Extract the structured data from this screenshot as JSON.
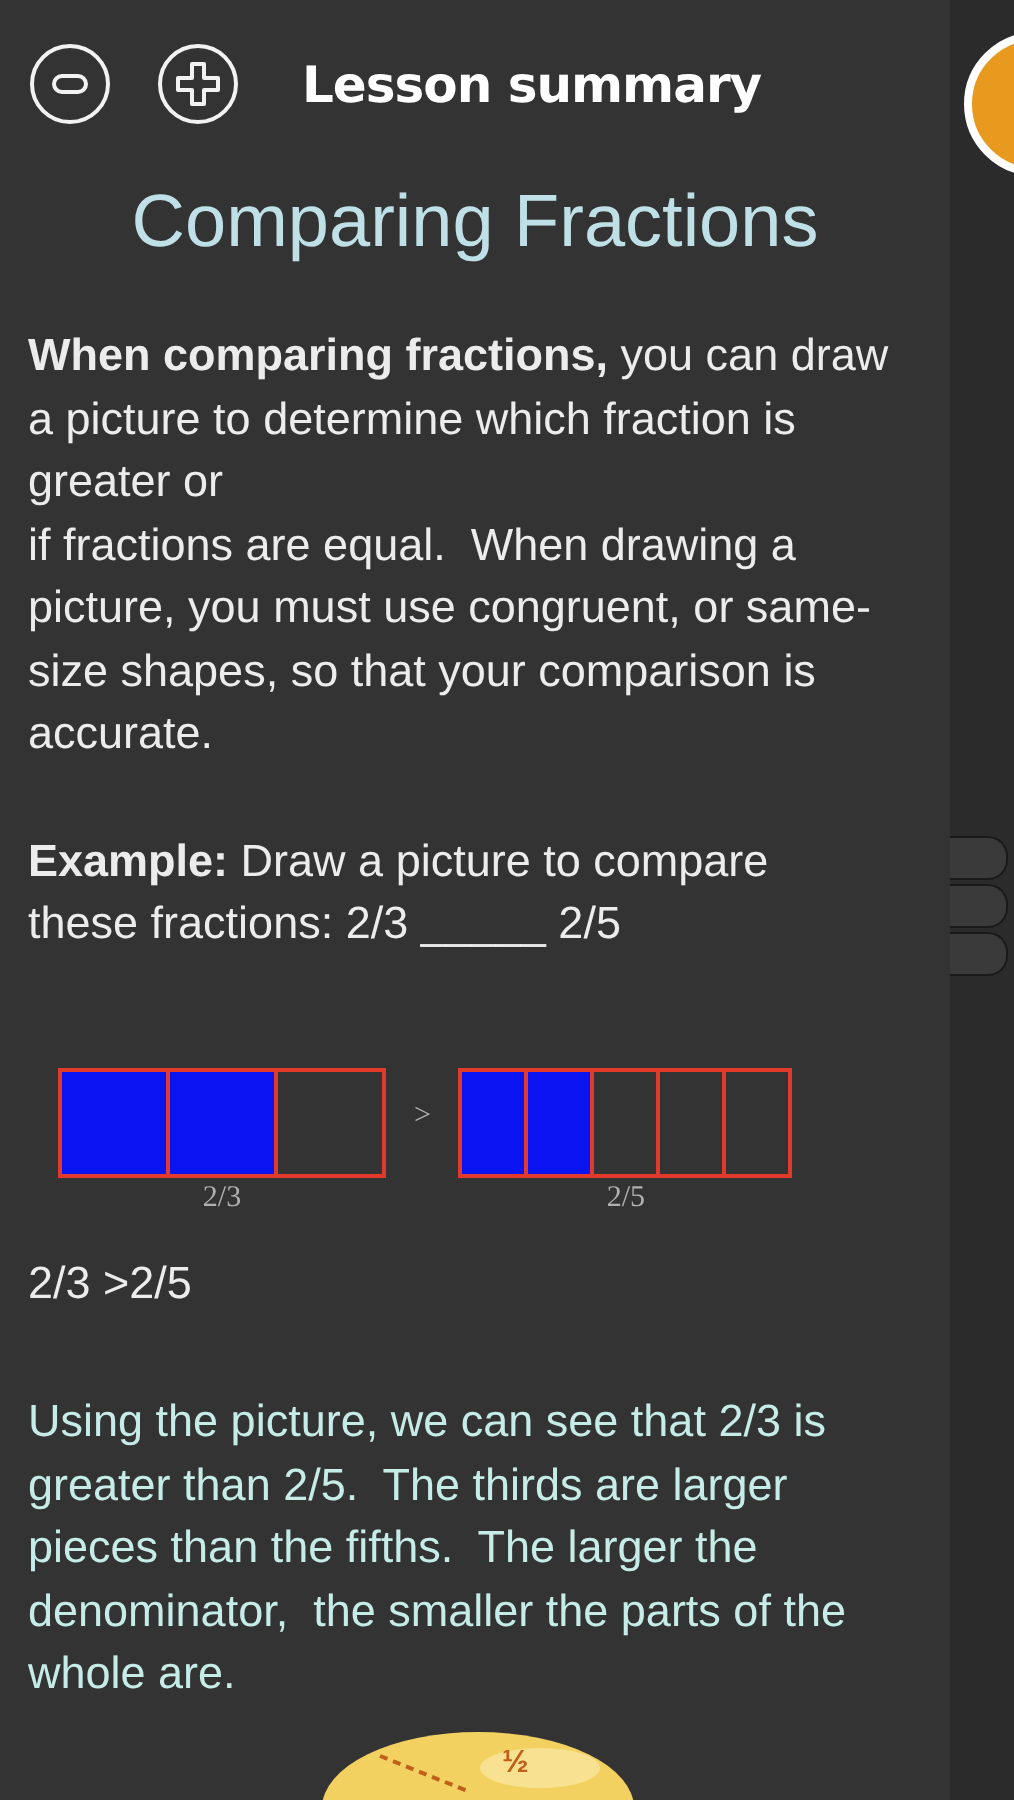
{
  "toolbar": {
    "title": "Lesson summary"
  },
  "lesson": {
    "title": "Comparing Fractions",
    "intro": "**When comparing fractions,** you can draw a picture to determine which fraction is greater or\nif fractions are equal.  When drawing a picture, you must use congruent, or same-size shapes, so that your comparison is accurate.",
    "example": "**Example:** Draw a picture to compare these fractions: 2/3 _____ 2/5",
    "models": [
      {
        "label": "2/3",
        "cells": [
          {
            "shaded": true
          },
          {
            "shaded": true
          },
          {
            "shaded": false
          }
        ]
      },
      {
        "label": "2/5",
        "cells": [
          {
            "shaded": true
          },
          {
            "shaded": true
          },
          {
            "shaded": false
          },
          {
            "shaded": false
          },
          {
            "shaded": false
          }
        ]
      }
    ],
    "comparison_sign": ">",
    "answer": "2/3 >2/5",
    "explanation": "Using the picture, we can see that 2/3 is greater than 2/5.  The thirds are larger pieces than the fifths.  The larger the denominator,  the smaller the parts of the whole are.",
    "coin_label": "½"
  }
}
